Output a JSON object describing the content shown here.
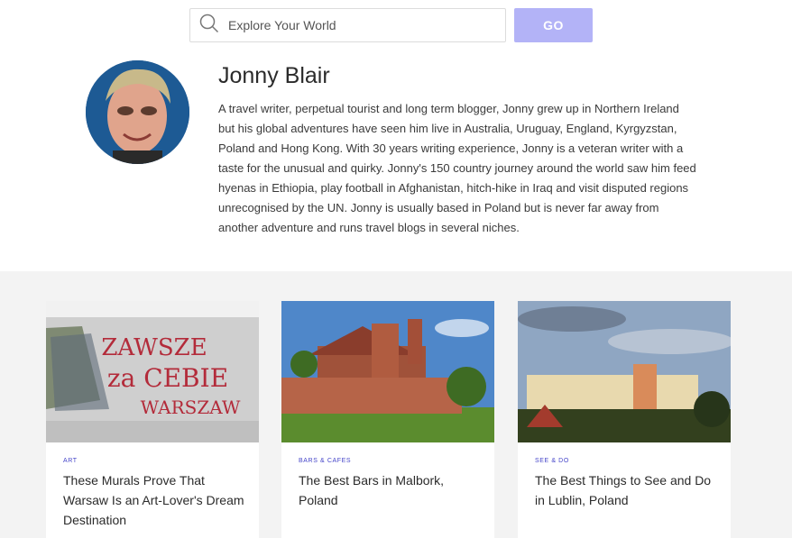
{
  "search": {
    "placeholder": "Explore Your World",
    "button_label": "GO"
  },
  "author": {
    "name": "Jonny Blair",
    "bio": "A travel writer, perpetual tourist and long term blogger, Jonny grew up in Northern Ireland but his global adventures have seen him live in Australia, Uruguay, England, Kyrgyzstan, Poland and Hong Kong. With 30 years writing experience, Jonny is a veteran writer with a taste for the unusual and quirky. Jonny's 150 country journey around the world saw him feed hyenas in Ethiopia, play football in Afghanistan, hitch-hike in Iraq and visit disputed regions unrecognised by the UN. Jonny is usually based in Poland but is never far away from another adventure and runs travel blogs in several niches."
  },
  "cards": [
    {
      "category": "ART",
      "title": "These Murals Prove That Warsaw Is an Art-Lover's Dream Destination"
    },
    {
      "category": "BARS & CAFES",
      "title": "The Best Bars in Malbork, Poland"
    },
    {
      "category": "SEE & DO",
      "title": "The Best Things to See and Do in Lublin, Poland"
    }
  ],
  "colors": {
    "accent": "#4545c9",
    "go_button": "#b3b3f7",
    "section_bg": "#f3f3f3"
  }
}
